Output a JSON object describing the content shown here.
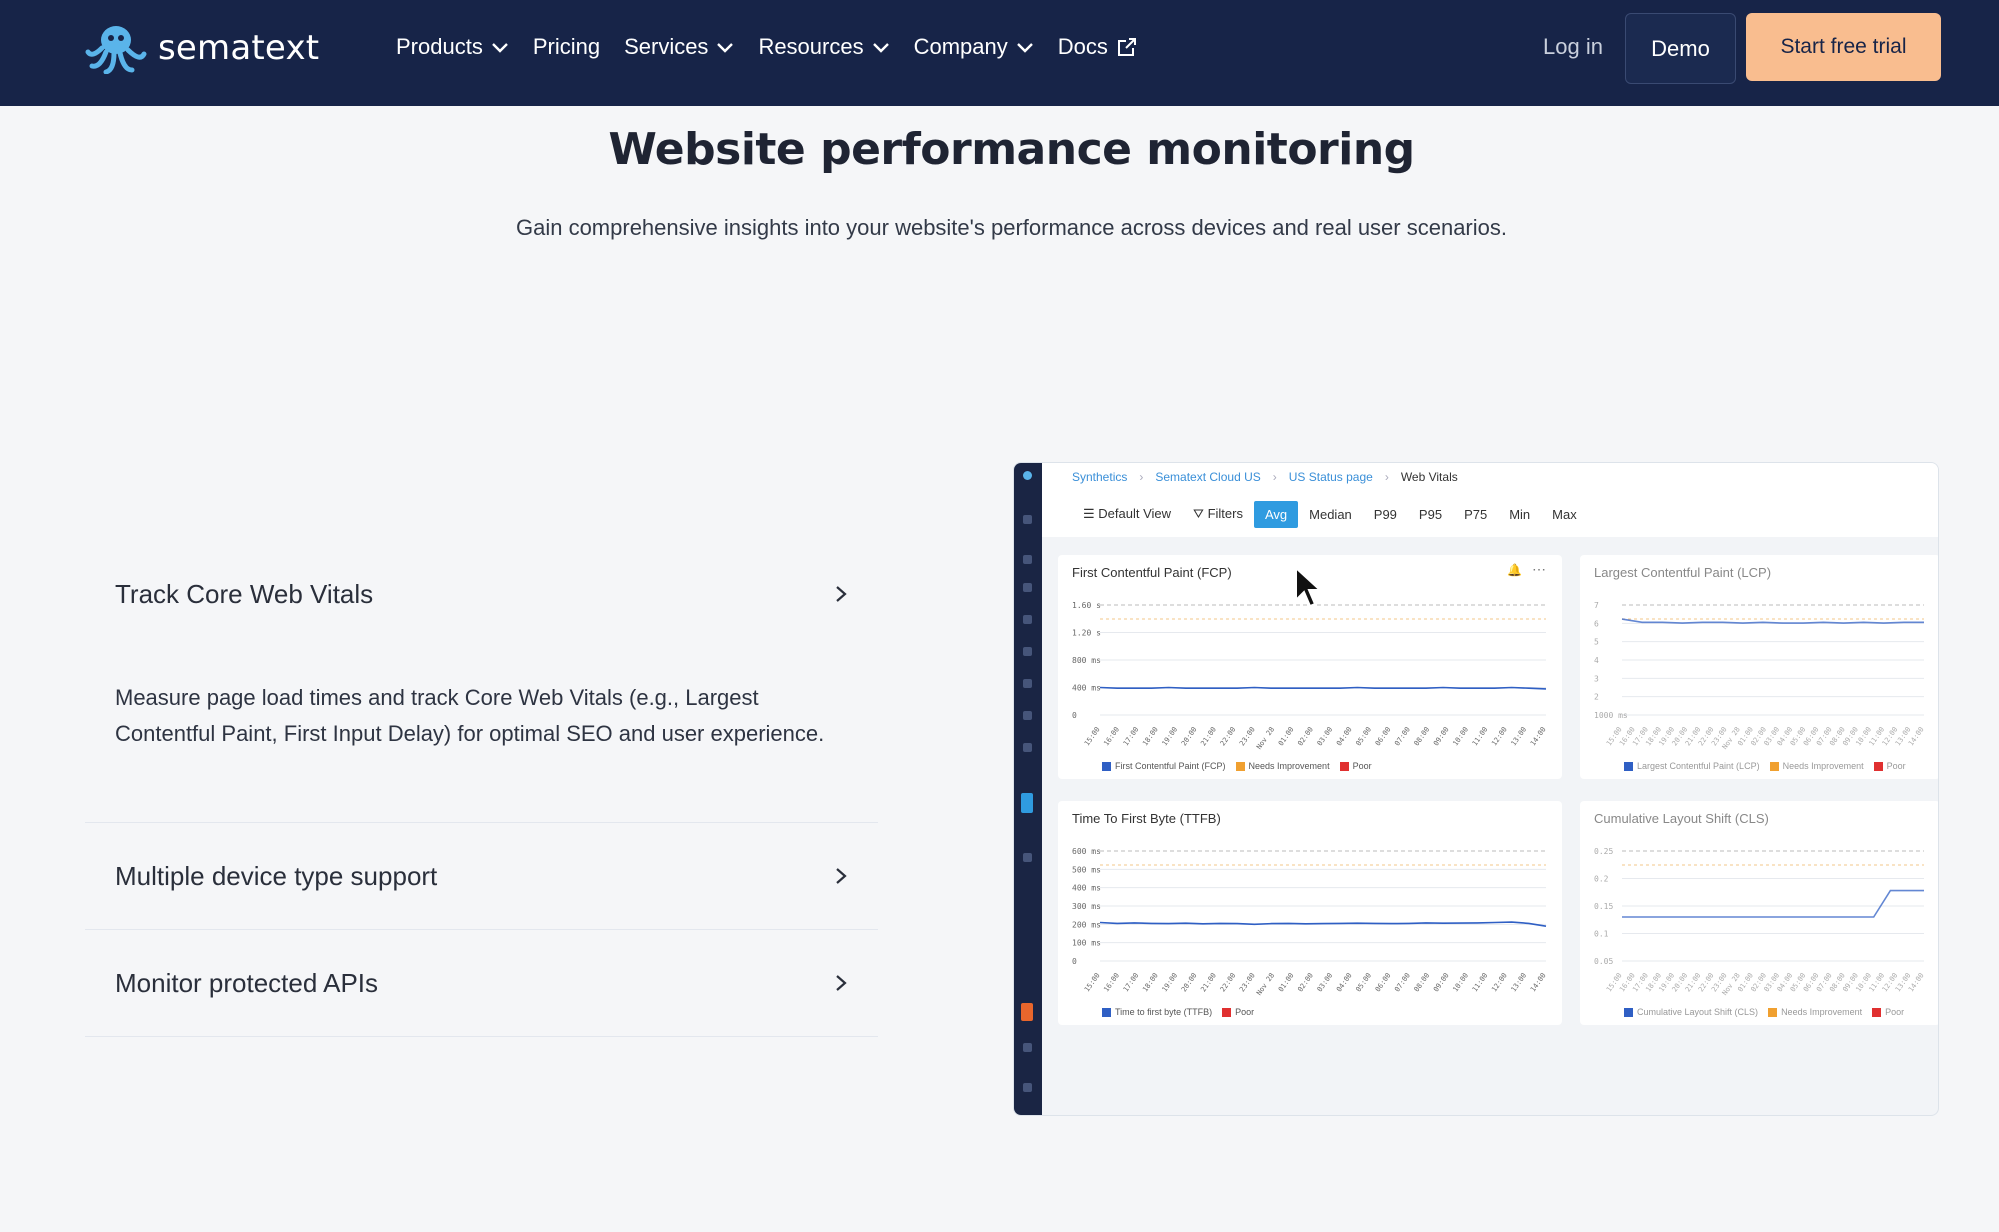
{
  "brand": {
    "name": "sematext"
  },
  "nav": {
    "items": [
      {
        "label": "Products",
        "dropdown": true
      },
      {
        "label": "Pricing",
        "dropdown": false
      },
      {
        "label": "Services",
        "dropdown": true
      },
      {
        "label": "Resources",
        "dropdown": true
      },
      {
        "label": "Company",
        "dropdown": true
      },
      {
        "label": "Docs",
        "external": true
      }
    ],
    "login": "Log in",
    "demo": "Demo",
    "trial": "Start free trial"
  },
  "hero": {
    "title": "Website performance monitoring",
    "subtitle": "Gain comprehensive insights into your website's performance across devices and real user scenarios."
  },
  "features": [
    {
      "title": "Track Core Web Vitals",
      "body": "Measure page load times and track Core Web Vitals (e.g., Largest Contentful Paint, First Input Delay) for optimal SEO and user experience.",
      "expanded": true
    },
    {
      "title": "Multiple device type support",
      "expanded": false
    },
    {
      "title": "Monitor protected APIs",
      "expanded": false
    }
  ],
  "screenshot": {
    "breadcrumbs": [
      "Synthetics",
      "Sematext Cloud US",
      "US Status page",
      "Web Vitals"
    ],
    "toolbar": {
      "view": "Default View",
      "filters": "Filters",
      "aggregations": [
        "Avg",
        "Median",
        "P99",
        "P95",
        "P75",
        "Min",
        "Max"
      ],
      "selected": "Avg"
    },
    "colors": {
      "series": "#2f5fc4",
      "needs_improvement": "#f0a030",
      "poor": "#e03030",
      "accent": "#2f9be0"
    },
    "panels": [
      {
        "title": "First Contentful Paint (FCP)",
        "yticks": [
          "1.60 s",
          "1.20 s",
          "800 ms",
          "400 ms",
          "0"
        ],
        "ymax": 1.6,
        "thresholds": [
          1.8,
          3.0
        ],
        "values": [
          0.4,
          0.39,
          0.39,
          0.39,
          0.4,
          0.39,
          0.39,
          0.39,
          0.39,
          0.4,
          0.39,
          0.39,
          0.39,
          0.39,
          0.39,
          0.4,
          0.39,
          0.39,
          0.39,
          0.39,
          0.4,
          0.39,
          0.39,
          0.39,
          0.4,
          0.39,
          0.38
        ],
        "legend": [
          "First Contentful Paint (FCP)",
          "Needs Improvement",
          "Poor"
        ]
      },
      {
        "title": "Largest Contentful Paint (LCP)",
        "yticks": [
          "7",
          "6",
          "5",
          "4",
          "3",
          "2",
          "1000 ms"
        ],
        "ymax": 7,
        "thresholds": [
          2.5,
          4.0
        ],
        "values": [
          6.1,
          5.9,
          5.9,
          5.85,
          5.9,
          5.9,
          5.85,
          5.9,
          5.85,
          5.85,
          5.9,
          5.85,
          5.9,
          5.85,
          5.9,
          5.9
        ],
        "legend": [
          "Largest Contentful Paint (LCP)",
          "Needs Improvement",
          "Poor"
        ]
      },
      {
        "title": "Time To First Byte (TTFB)",
        "yticks": [
          "600 ms",
          "500 ms",
          "400 ms",
          "300 ms",
          "200 ms",
          "100 ms",
          "0"
        ],
        "ymax": 600,
        "thresholds": [
          800,
          1800
        ],
        "values": [
          210,
          205,
          208,
          205,
          204,
          206,
          203,
          205,
          204,
          200,
          204,
          205,
          203,
          204,
          205,
          206,
          205,
          204,
          205,
          208,
          206,
          207,
          208,
          210,
          212,
          205,
          190
        ],
        "legend": [
          "Time to first byte (TTFB)",
          "Poor"
        ]
      },
      {
        "title": "Cumulative Layout Shift (CLS)",
        "yticks": [
          "0.25",
          "0.2",
          "0.15",
          "0.1",
          "0.05"
        ],
        "ymax": 0.25,
        "thresholds": [
          0.1,
          0.25
        ],
        "values": [
          0.1,
          0.1,
          0.1,
          0.1,
          0.1,
          0.1,
          0.1,
          0.1,
          0.1,
          0.1,
          0.1,
          0.1,
          0.1,
          0.1,
          0.1,
          0.1,
          0.16,
          0.16,
          0.16
        ],
        "legend": [
          "Cumulative Layout Shift (CLS)",
          "Needs Improvement",
          "Poor"
        ]
      }
    ],
    "xticks": [
      "15:00",
      "16:00",
      "17:00",
      "18:00",
      "19:00",
      "20:00",
      "21:00",
      "22:00",
      "23:00",
      "Nov 28",
      "01:00",
      "02:00",
      "03:00",
      "04:00",
      "05:00",
      "06:00",
      "07:00",
      "08:00",
      "09:00",
      "10:00",
      "11:00",
      "12:00",
      "13:00",
      "14:00"
    ]
  }
}
